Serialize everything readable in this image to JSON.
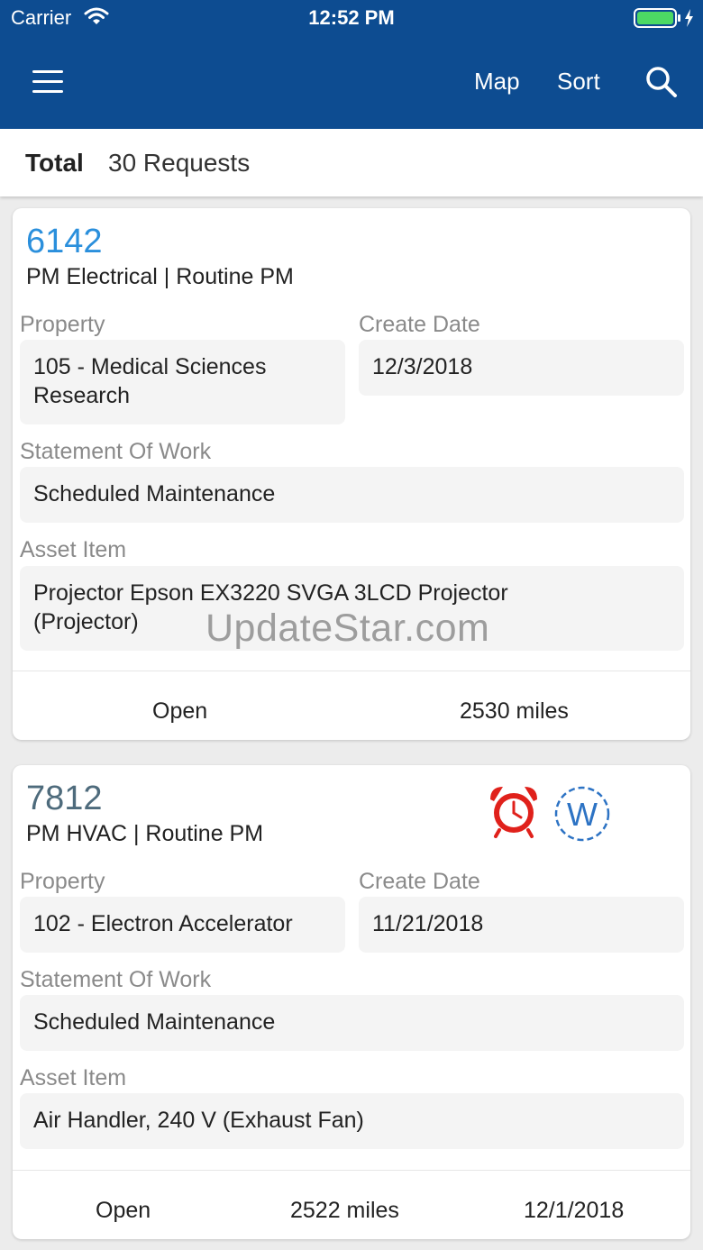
{
  "status_bar": {
    "carrier": "Carrier",
    "time": "12:52 PM"
  },
  "nav": {
    "map_label": "Map",
    "sort_label": "Sort"
  },
  "summary": {
    "total_label": "Total",
    "total_value": "30 Requests"
  },
  "requests": [
    {
      "id": "6142",
      "type": "PM Electrical | Routine PM",
      "property_label": "Property",
      "property_line1": "105 - Medical Sciences",
      "property_line2": "Research",
      "create_date_label": "Create Date",
      "create_date": "12/3/2018",
      "sow_label": "Statement Of Work",
      "sow": "Scheduled Maintenance",
      "asset_label": "Asset Item",
      "asset_line1": "Projector Epson EX3220 SVGA 3LCD Projector",
      "asset_line2": "(Projector)",
      "status": "Open",
      "distance": "2530 miles"
    },
    {
      "id": "7812",
      "type": "PM HVAC | Routine PM",
      "property_label": "Property",
      "property_line1": "102 - Electron Accelerator",
      "create_date_label": "Create Date",
      "create_date": "11/21/2018",
      "sow_label": "Statement Of Work",
      "sow": "Scheduled Maintenance",
      "asset_label": "Asset Item",
      "asset_line1": "Air Handler, 240 V (Exhaust Fan)",
      "status": "Open",
      "distance": "2522 miles",
      "due_date": "12/1/2018",
      "badge_letter": "W",
      "icons": [
        "alarm-clock-icon",
        "w-badge-icon"
      ]
    }
  ],
  "watermark": "UpdateStar.com",
  "colors": {
    "header_bg": "#0d4c91",
    "id_blue": "#2a8fdc",
    "id_slate": "#4e6b7c",
    "alarm_red": "#e0211b",
    "battery_green": "#4cd964"
  }
}
